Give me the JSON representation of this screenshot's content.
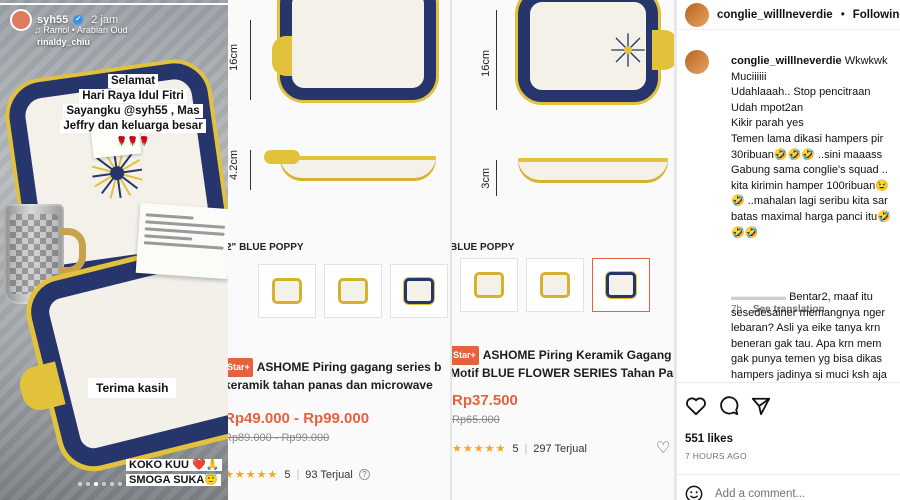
{
  "story": {
    "username": "syh55",
    "time": "2 jam",
    "music": "Ramol • Arabian Oud",
    "tag": "rinaldy_chiu",
    "greeting_lines": [
      "Selamat",
      "Hari Raya Idul Fitri",
      "Sayangku @syh55 , Mas",
      "Jeffry dan keluarga besar"
    ],
    "hearts": "🌹🌹🌹",
    "thanks": "Terima kasih",
    "closing_lines": [
      "KOKO KUU ❤️🙏",
      "SMOGA SUKA😇"
    ]
  },
  "product1": {
    "dim_top": "16cm",
    "dim_side": "4.2cm",
    "series": "2\" BLUE POPPY",
    "badge": "Star+",
    "title_lines": [
      "ASHOME Piring gagang series b",
      "keramik tahan panas dan microwave"
    ],
    "price": "Rp49.000 - Rp99.000",
    "old_price": "Rp89.000 - Rp99.000",
    "rating": "5",
    "sold": "93 Terjual"
  },
  "product2": {
    "dim_top": "16cm",
    "dim_side": "3cm",
    "series": "BLUE POPPY",
    "badge": "Star+",
    "title_lines": [
      "ASHOME Piring Keramik Gagang",
      "Motif BLUE FLOWER SERIES Tahan Panas"
    ],
    "price": "Rp37.500",
    "old_price": "Rp65.000",
    "rating": "5",
    "sold": "297 Terjual"
  },
  "instagram": {
    "account": "conglie_willlneverdie",
    "follow": "Following",
    "comment_user": "conglie_willlneverdie",
    "comment_lines": [
      "Wkwkwk",
      "Muciiiiii",
      "Udahlaaah.. Stop pencitraan",
      "Udah mpot2an",
      "Kikir parah yes",
      "Temen lama dikasi hampers pir",
      "30ribuan🤣🤣🤣 ..sini maaass",
      "Gabung sama conglie's squad ..",
      "kita kirimin hamper 100ribuan😉",
      "🤣 ..mahalan lagi seribu kita sar",
      "batas maximal harga panci itu🤣",
      "🤣🤣"
    ],
    "comment_time": "7h",
    "see_translation": "See translation",
    "reply_lines": [
      "Bentar2, maaf itu",
      "sesedesainer memangnya nger",
      "lebaran? Asli ya eike tanya krn",
      "beneran gak tau. Apa krn mem",
      "gak punya temen yg bisa dikas",
      "hampers jadinya si muci ksh aja"
    ],
    "likes": "551 likes",
    "posted": "7 HOURS AGO",
    "add_comment_placeholder": "Add a comment..."
  }
}
